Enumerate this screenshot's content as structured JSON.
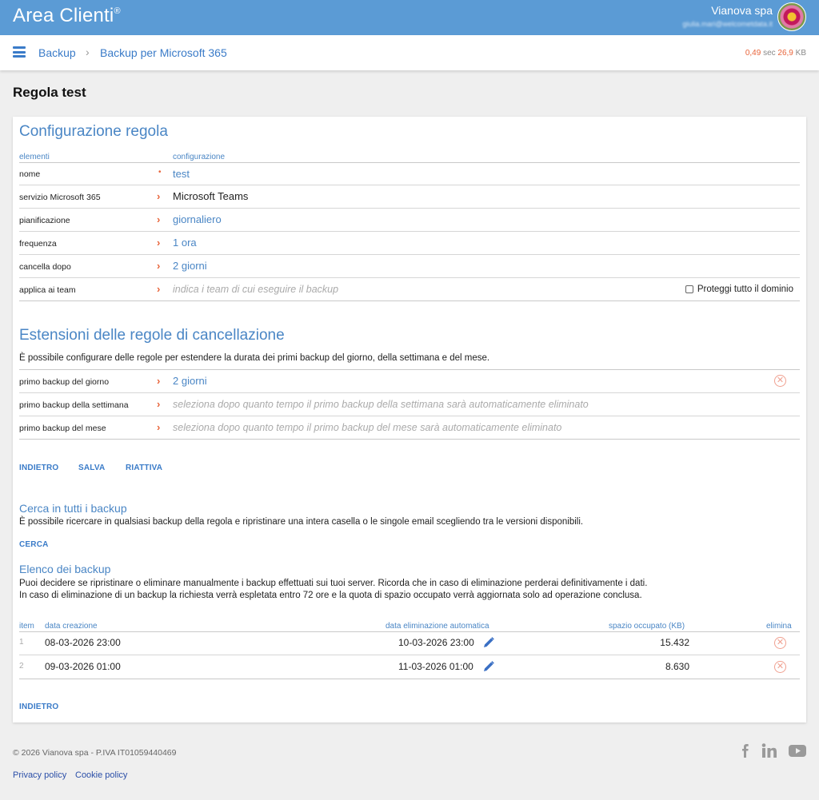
{
  "header": {
    "brand": "Area Clienti",
    "brand_mark": "®",
    "company": "Vianova spa",
    "email": "giulia.mari@welcometdata.it"
  },
  "breadcrumb": {
    "items": [
      "Backup",
      "Backup per Microsoft 365"
    ],
    "separator": "›"
  },
  "perf": {
    "time": "0,49",
    "time_unit": "sec",
    "size": "26,9",
    "size_unit": "KB"
  },
  "page_title": "Regola test",
  "config": {
    "title": "Configurazione regola",
    "col_elements": "elementi",
    "col_config": "configurazione",
    "rows": [
      {
        "label": "nome",
        "value": "test"
      },
      {
        "label": "servizio Microsoft 365",
        "value": "Microsoft Teams"
      },
      {
        "label": "pianificazione",
        "value": "giornaliero"
      },
      {
        "label": "frequenza",
        "value": "1 ora"
      },
      {
        "label": "cancella dopo",
        "value": "2 giorni"
      },
      {
        "label": "applica ai team",
        "value": "indica i team di cui eseguire il backup"
      }
    ],
    "protect_domain": "Proteggi tutto il dominio"
  },
  "extensions": {
    "title": "Estensioni delle regole di cancellazione",
    "description": "È possibile configurare delle regole per estendere la durata dei primi backup del giorno, della settimana e del mese.",
    "rows": [
      {
        "label": "primo backup del giorno",
        "value": "2 giorni"
      },
      {
        "label": "primo backup della settimana",
        "value": "seleziona dopo quanto tempo il primo backup della settimana sarà automaticamente eliminato"
      },
      {
        "label": "primo backup del mese",
        "value": "seleziona dopo quanto tempo il primo backup del mese sarà automaticamente eliminato"
      }
    ]
  },
  "actions": {
    "back": "INDIETRO",
    "save": "SALVA",
    "reactivate": "RIATTIVA"
  },
  "search": {
    "title": "Cerca in tutti i backup",
    "description": "È possibile ricercare in qualsiasi backup della regola e ripristinare una intera casella o le singole email scegliendo tra le versioni disponibili.",
    "button": "CERCA"
  },
  "backups": {
    "title": "Elenco dei backup",
    "description1": "Puoi decidere se ripristinare o eliminare manualmente i backup effettuati sui tuoi server. Ricorda che in caso di eliminazione perderai definitivamente i dati.",
    "description2": "In caso di eliminazione di un backup la richiesta verrà espletata entro 72 ore e la quota di spazio occupato verrà aggiornata solo ad operazione conclusa.",
    "columns": [
      "item",
      "data creazione",
      "data eliminazione automatica",
      "spazio occupato (KB)",
      "elimina"
    ],
    "rows": [
      {
        "item": "1",
        "created": "08-03-2026 23:00",
        "auto_delete": "10-03-2026 23:00",
        "size": "15.432"
      },
      {
        "item": "2",
        "created": "09-03-2026 01:00",
        "auto_delete": "11-03-2026 01:00",
        "size": "8.630"
      }
    ],
    "back": "INDIETRO"
  },
  "footer": {
    "copyright": "© 2026 Vianova spa - P.IVA IT01059440469",
    "privacy": "Privacy policy",
    "cookie": "Cookie policy",
    "social_icons": [
      "facebook-icon",
      "linkedin-icon",
      "youtube-icon"
    ]
  },
  "colors": {
    "header_bg": "#5b9bd5",
    "link": "#3a7bc8",
    "accent": "#e8643a"
  }
}
